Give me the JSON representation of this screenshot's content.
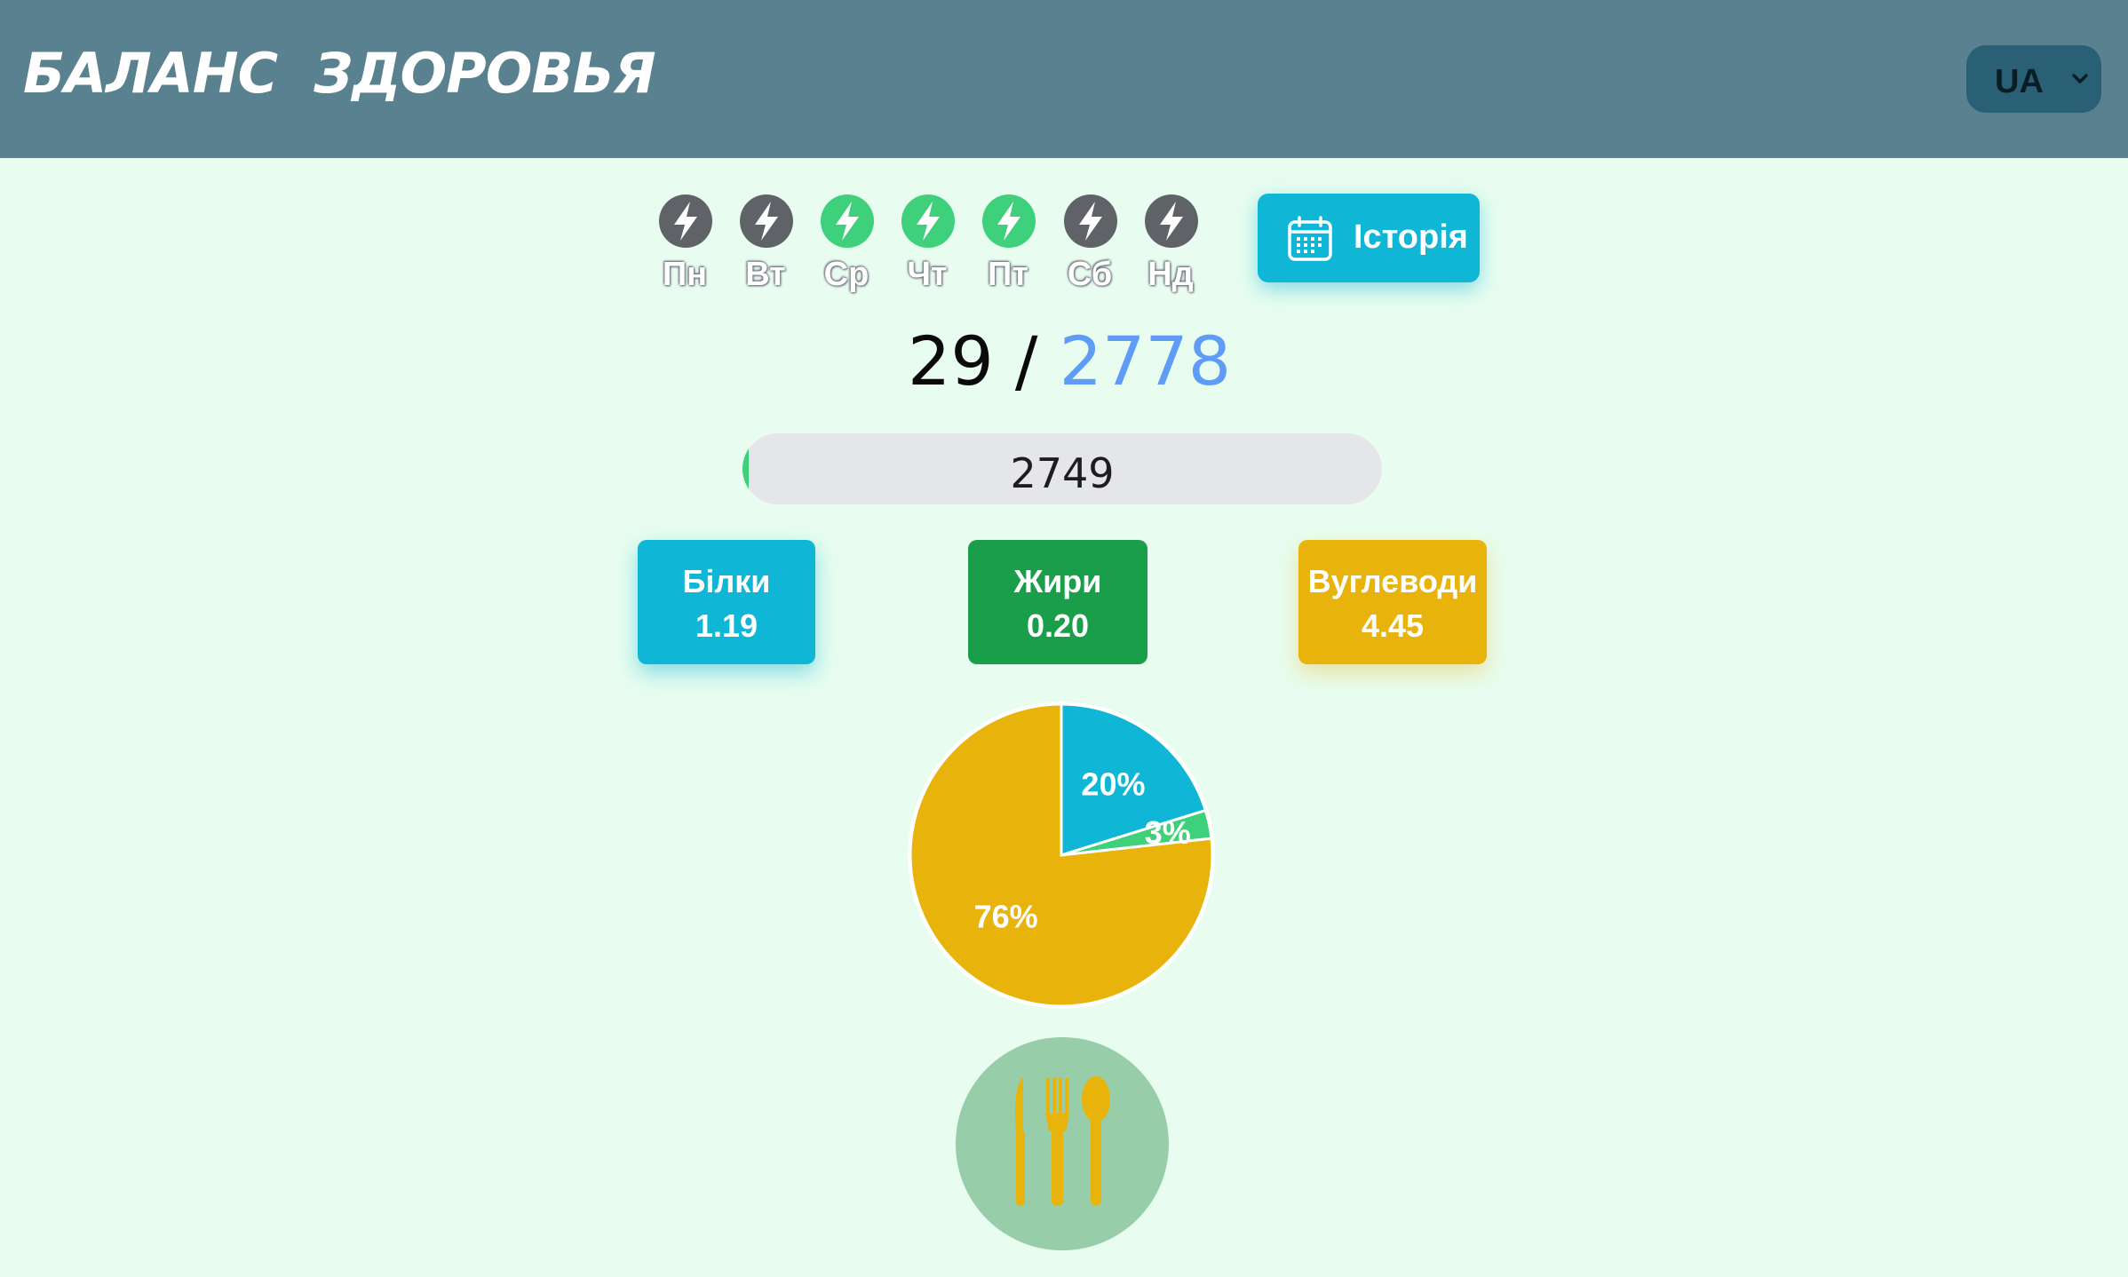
{
  "header": {
    "brand": "БАЛАНС  ЗДОРОВЬЯ",
    "language": "UA",
    "language_icon": "chevron-down-icon"
  },
  "week": {
    "days": [
      {
        "label": "Пн",
        "active": false
      },
      {
        "label": "Вт",
        "active": false
      },
      {
        "label": "Ср",
        "active": true
      },
      {
        "label": "Чт",
        "active": true
      },
      {
        "label": "Пт",
        "active": true
      },
      {
        "label": "Сб",
        "active": false
      },
      {
        "label": "Нд",
        "active": false
      }
    ],
    "active_color": "#3ed07a",
    "inactive_color": "#5f6267",
    "icon": "lightning-icon"
  },
  "history": {
    "label": "Історія",
    "icon": "calendar-icon"
  },
  "calories": {
    "consumed": "29",
    "separator": " / ",
    "target": "2778",
    "remaining": "2749",
    "progress_fraction": 0.0104
  },
  "macros": {
    "protein": {
      "label": "Білки",
      "value": "1.19",
      "color": "#0fb6d6"
    },
    "fat": {
      "label": "Жири",
      "value": "0.20",
      "color": "#1a9e4a"
    },
    "carbs": {
      "label": "Вуглеводи",
      "value": "4.45",
      "color": "#e8b30b"
    }
  },
  "chart_data": {
    "type": "pie",
    "slices": [
      {
        "label": "20%",
        "value": 20,
        "color": "#0fb6d6"
      },
      {
        "label": "3%",
        "value": 3,
        "color": "#3ed07a"
      },
      {
        "label": "76%",
        "value": 76,
        "color": "#e8b30b"
      }
    ]
  },
  "meal_button": {
    "icon": "cutlery-icon",
    "background": "#97cda9",
    "icon_color": "#e8b30b"
  }
}
